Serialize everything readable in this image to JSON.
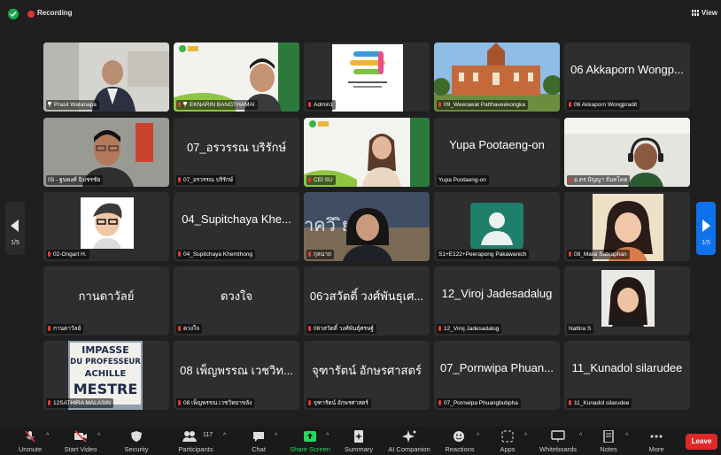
{
  "topbar": {
    "recording_label": "Recording",
    "view_label": "View"
  },
  "pager": {
    "left_label": "1/5",
    "right_label": "1/5"
  },
  "tiles": [
    {
      "name": "Prasit Watanapa"
    },
    {
      "name": "EKNARIN BANGTHAMAI"
    },
    {
      "name": "Admin1"
    },
    {
      "name": "09_Weerawat Patthaveekongka"
    },
    {
      "name": "06 Akkaporn Wongpradit",
      "big": "06 Akkaporn Wongp..."
    },
    {
      "name": "05 - ฐนพงศ์ ฉิมชรชัย"
    },
    {
      "name": "07_อรวรรณ บริรักษ์",
      "big": "07_อรวรรณ บริรักษ์"
    },
    {
      "name": "CEI SU"
    },
    {
      "name": "Yupa Pootaeng-on",
      "big": "Yupa Pootaeng-on"
    },
    {
      "name": "อ.ดร.ปัญญา จันทโคต"
    },
    {
      "name": "02-Ongart H."
    },
    {
      "name": "04_Supitchaya Khemthong",
      "big": "04_Supitchaya Khe..."
    },
    {
      "name": "กุลนาถ",
      "banner": "าควิ ิยา"
    },
    {
      "name": "S1+E122+Peerapong Pakawanich"
    },
    {
      "name": "08_Malai Satiraphan"
    },
    {
      "name": "กานดาวัลย์",
      "big": "กานดาวัลย์"
    },
    {
      "name": "ดวงใจ",
      "big": "ดวงใจ"
    },
    {
      "name": "06วสวัตติ์ วงศ์พันธุ์ศรษฐ์",
      "big": "06วสวัตติ์ วงศ์พันธุเศ..."
    },
    {
      "name": "12_Viroj Jadesadalug",
      "big": "12_Viroj Jadesadalug"
    },
    {
      "name": "Nattira S"
    },
    {
      "name": "12SATHIRA MALASIN",
      "sign": [
        "IMPASSE",
        "DU PROFESSEUR",
        "ACHILLE",
        "MESTRE"
      ]
    },
    {
      "name": "08 เพ็ญพรรณ เวชวิทยาขลัง",
      "big": "08 เพ็ญพรรณ เวชวิท..."
    },
    {
      "name": "จุฑารัตน์ อักษรศาสตร์",
      "big": "จุฑารัตน์ อักษรศาสตร์"
    },
    {
      "name": "07_Pornwipa Phuangbubpha",
      "big": "07_Pornwipa Phuan..."
    },
    {
      "name": "11_Kunadol silarudee",
      "big": "11_Kunadol silarudee"
    }
  ],
  "toolbar": {
    "unmute": "Unmute",
    "start_video": "Start Video",
    "security": "Security",
    "participants": "Participants",
    "participants_count": "117",
    "chat": "Chat",
    "share_screen": "Share Screen",
    "summary": "Summary",
    "ai_companion": "AI Companion",
    "reactions": "Reactions",
    "apps": "Apps",
    "whiteboards": "Whiteboards",
    "notes": "Notes",
    "more": "More",
    "leave": "Leave"
  },
  "colors": {
    "accent_green": "#23d959",
    "leave_red": "#e02828",
    "nav_blue": "#0e72ed",
    "tile_bg": "#2e2e2e"
  }
}
